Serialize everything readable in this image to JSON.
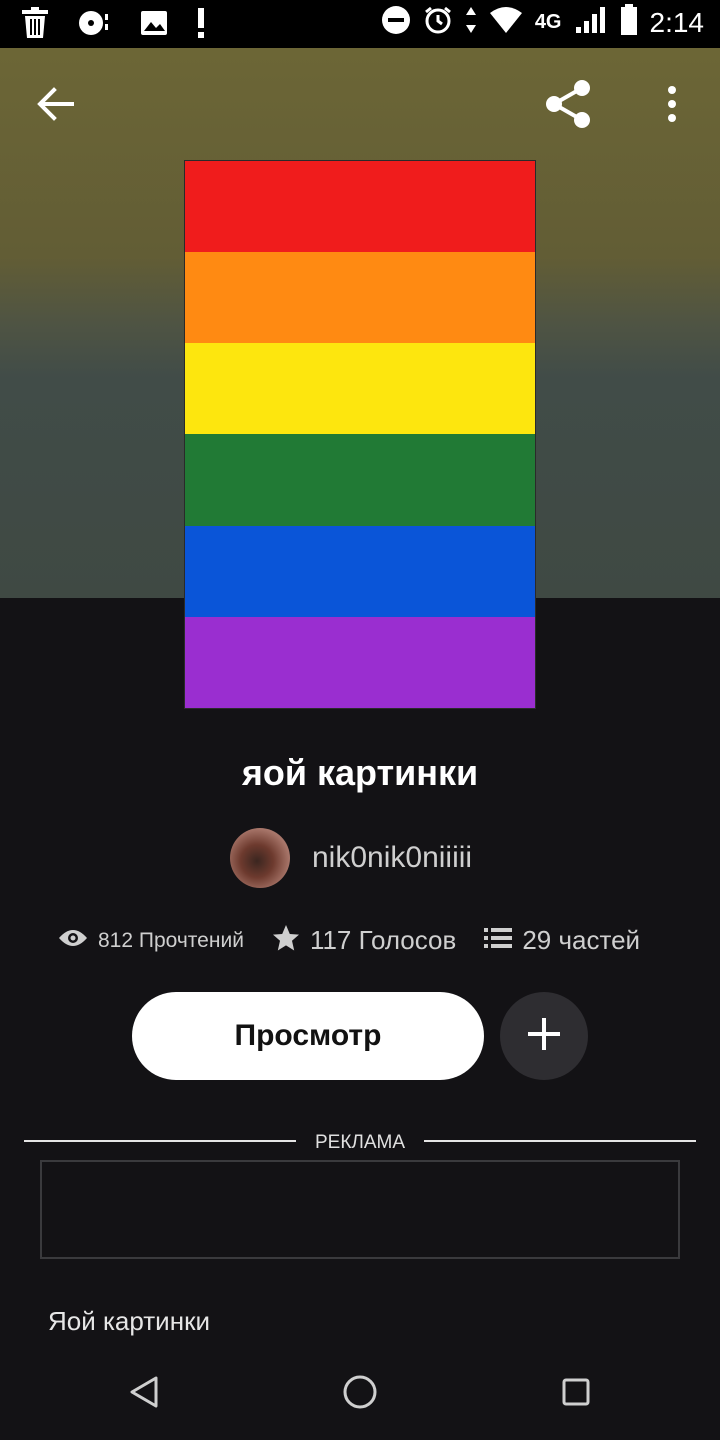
{
  "status_bar": {
    "time": "2:14",
    "network": "4G",
    "left_icons": [
      "trash-icon",
      "music-disc-icon",
      "image-icon",
      "alert-icon"
    ],
    "right_icons": [
      "dnd-icon",
      "alarm-icon",
      "data-arrows-icon",
      "wifi-icon",
      "signal-icon",
      "battery-icon"
    ]
  },
  "toolbar": {
    "back_icon": "arrow-left-icon",
    "share_icon": "share-icon",
    "more_icon": "more-vertical-icon"
  },
  "cover": {
    "stripes": [
      "#f01c1c",
      "#ff8a12",
      "#fde60e",
      "#217a35",
      "#0a55d8",
      "#9a2ed0"
    ]
  },
  "story": {
    "title": "яой картинки",
    "author": "nik0nik0niiiii",
    "reads": "812 Прочтений",
    "votes": "117 Голосов",
    "parts": "29 частей"
  },
  "actions": {
    "read_label": "Просмотр",
    "add_icon": "plus-icon"
  },
  "ad": {
    "label": "РЕКЛАМА"
  },
  "parts_list": {
    "first_part_title": "Яой картинки"
  },
  "nav": {
    "icons": [
      "back-triangle-icon",
      "home-circle-icon",
      "recents-square-icon"
    ]
  }
}
